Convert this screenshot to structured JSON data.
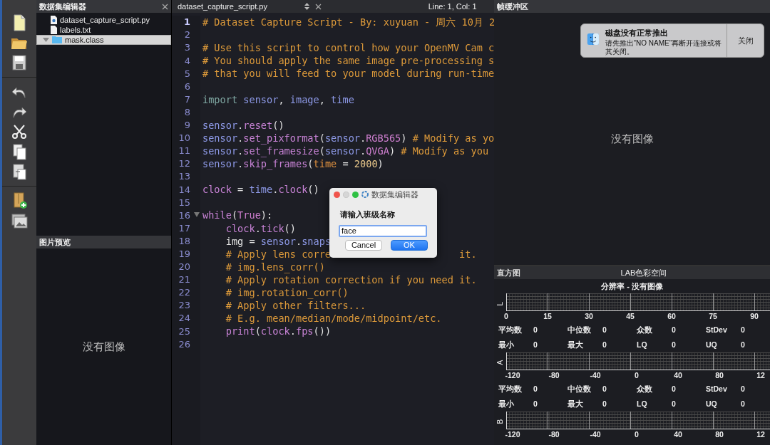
{
  "dataset_panel": {
    "title": "数据集编辑器",
    "files": [
      {
        "name": "dataset_capture_script.py",
        "kind": "python",
        "selected": false
      },
      {
        "name": "labels.txt",
        "kind": "text",
        "selected": false
      },
      {
        "name": "mask.class",
        "kind": "folder",
        "selected": true,
        "expanded": true
      }
    ],
    "preview": {
      "title": "图片预览",
      "message": "没有图像"
    }
  },
  "editor": {
    "tab": "dataset_capture_script.py",
    "position": "Line: 1, Col: 1",
    "lines": [
      {
        "number": "1",
        "current": true,
        "tokens": [
          {
            "kind": "comment",
            "t": "# Dataset Capture Script - By: xuyuan - 周六 10月 2"
          }
        ]
      },
      {
        "number": "2",
        "current": false
      },
      {
        "number": "3",
        "current": false,
        "tokens": [
          {
            "kind": "comment",
            "t": "# Use this script to control how your OpenMV Cam c"
          }
        ]
      },
      {
        "number": "4",
        "current": false,
        "tokens": [
          {
            "kind": "comment",
            "t": "# You should apply the same image pre-processing s"
          }
        ]
      },
      {
        "number": "5",
        "current": false,
        "tokens": [
          {
            "kind": "comment",
            "t": "# that you will feed to your model during run-time"
          }
        ]
      },
      {
        "number": "6",
        "current": false
      },
      {
        "number": "7",
        "current": false,
        "tokens": [
          {
            "kind": "keyword",
            "t": "import"
          },
          {
            "kind": "module",
            "t": " sensor"
          },
          {
            "kind": "plain",
            "t": ", "
          },
          {
            "kind": "module",
            "t": "image"
          },
          {
            "kind": "plain",
            "t": ", "
          },
          {
            "kind": "module",
            "t": "time"
          }
        ]
      },
      {
        "number": "8",
        "current": false
      },
      {
        "number": "9",
        "current": false,
        "tokens": [
          {
            "kind": "module",
            "t": "sensor"
          },
          {
            "kind": "plain",
            "t": "."
          },
          {
            "kind": "func",
            "t": "reset"
          },
          {
            "kind": "plain",
            "t": "()"
          }
        ]
      },
      {
        "number": "10",
        "current": false,
        "tokens": [
          {
            "kind": "module",
            "t": "sensor"
          },
          {
            "kind": "plain",
            "t": "."
          },
          {
            "kind": "func",
            "t": "set_pixformat"
          },
          {
            "kind": "plain",
            "t": "("
          },
          {
            "kind": "module",
            "t": "sensor"
          },
          {
            "kind": "plain",
            "t": "."
          },
          {
            "kind": "const",
            "t": "RGB565"
          },
          {
            "kind": "plain",
            "t": ")"
          },
          {
            "kind": "comment",
            "t": " # Modify as yo"
          }
        ]
      },
      {
        "number": "11",
        "current": false,
        "tokens": [
          {
            "kind": "module",
            "t": "sensor"
          },
          {
            "kind": "plain",
            "t": "."
          },
          {
            "kind": "func",
            "t": "set_framesize"
          },
          {
            "kind": "plain",
            "t": "("
          },
          {
            "kind": "module",
            "t": "sensor"
          },
          {
            "kind": "plain",
            "t": "."
          },
          {
            "kind": "const",
            "t": "QVGA"
          },
          {
            "kind": "plain",
            "t": ")"
          },
          {
            "kind": "comment",
            "t": " # Modify as you"
          }
        ]
      },
      {
        "number": "12",
        "current": false,
        "tokens": [
          {
            "kind": "module",
            "t": "sensor"
          },
          {
            "kind": "plain",
            "t": "."
          },
          {
            "kind": "func",
            "t": "skip_frames"
          },
          {
            "kind": "plain",
            "t": "("
          },
          {
            "kind": "param",
            "t": "time"
          },
          {
            "kind": "plain",
            "t": " = "
          },
          {
            "kind": "number",
            "t": "2000"
          },
          {
            "kind": "plain",
            "t": ")"
          }
        ]
      },
      {
        "number": "13",
        "current": false
      },
      {
        "number": "14",
        "current": false,
        "tokens": [
          {
            "kind": "func",
            "t": "clock"
          },
          {
            "kind": "plain",
            "t": " = "
          },
          {
            "kind": "module",
            "t": "time"
          },
          {
            "kind": "plain",
            "t": "."
          },
          {
            "kind": "func",
            "t": "clock"
          },
          {
            "kind": "plain",
            "t": "()"
          }
        ]
      },
      {
        "number": "15",
        "current": false
      },
      {
        "number": "16",
        "current": false,
        "foldable": true,
        "tokens": [
          {
            "kind": "func",
            "t": "while"
          },
          {
            "kind": "plain",
            "t": "("
          },
          {
            "kind": "const",
            "t": "True"
          },
          {
            "kind": "plain",
            "t": "):"
          }
        ]
      },
      {
        "number": "17",
        "current": false,
        "indented": true,
        "tokens": [
          {
            "kind": "func",
            "t": "clock"
          },
          {
            "kind": "plain",
            "t": "."
          },
          {
            "kind": "func",
            "t": "tick"
          },
          {
            "kind": "plain",
            "t": "()"
          }
        ]
      },
      {
        "number": "18",
        "current": false,
        "indented": true,
        "tokens": [
          {
            "kind": "plain",
            "t": "img = "
          },
          {
            "kind": "module",
            "t": "sensor"
          },
          {
            "kind": "plain",
            "t": "."
          },
          {
            "kind": "module",
            "t": "snaps"
          }
        ]
      },
      {
        "number": "19",
        "current": false,
        "indented": true,
        "tokens": [
          {
            "kind": "comment",
            "t": "# Apply lens corre"
          },
          {
            "kind": "comment",
            "t": "it.",
            "gap": true
          }
        ]
      },
      {
        "number": "20",
        "current": false,
        "indented": true,
        "tokens": [
          {
            "kind": "comment",
            "t": "# img.lens_corr()"
          }
        ]
      },
      {
        "number": "21",
        "current": false,
        "indented": true,
        "tokens": [
          {
            "kind": "comment",
            "t": "# Apply rotation correction if you need it."
          }
        ]
      },
      {
        "number": "22",
        "current": false,
        "indented": true,
        "tokens": [
          {
            "kind": "comment",
            "t": "# img.rotation_corr()"
          }
        ]
      },
      {
        "number": "23",
        "current": false,
        "indented": true,
        "tokens": [
          {
            "kind": "comment",
            "t": "# Apply other filters..."
          }
        ]
      },
      {
        "number": "24",
        "current": false,
        "indented": true,
        "tokens": [
          {
            "kind": "comment",
            "t": "# E.g. mean/median/mode/midpoint/etc."
          }
        ]
      },
      {
        "number": "25",
        "current": false,
        "indented": true,
        "tokens": [
          {
            "kind": "func",
            "t": "print"
          },
          {
            "kind": "plain",
            "t": "("
          },
          {
            "kind": "func",
            "t": "clock"
          },
          {
            "kind": "plain",
            "t": "."
          },
          {
            "kind": "func",
            "t": "fps"
          },
          {
            "kind": "plain",
            "t": "())"
          }
        ]
      },
      {
        "number": "26",
        "current": false
      }
    ]
  },
  "dialog": {
    "title": "数据集编辑器",
    "prompt": "请输入班级名称",
    "value": "face",
    "buttons": [
      {
        "label": "Cancel",
        "default": false
      },
      {
        "label": "OK",
        "default": true
      }
    ]
  },
  "frame_buffer": {
    "title": "帧缓冲区",
    "message": "没有图像"
  },
  "notification": {
    "title": "磁盘没有正常推出",
    "body": "请先推出“NO NAME”再断开连接或将其关闭。",
    "button": "关闭"
  },
  "histogram": {
    "title": "直方图",
    "color_space": "LAB色彩空间",
    "resolution": "分辨率 - 没有图像",
    "channels": [
      {
        "axis": "L",
        "ticks": [
          "0",
          "15",
          "30",
          "45",
          "60",
          "75",
          "90"
        ],
        "stats": [
          {
            "label": "平均数",
            "value": "0"
          },
          {
            "label": "中位数",
            "value": "0"
          },
          {
            "label": "众数",
            "value": "0"
          },
          {
            "label": "StDev",
            "value": "0"
          },
          {
            "label": "最小",
            "value": "0"
          },
          {
            "label": "最大",
            "value": "0"
          },
          {
            "label": "LQ",
            "value": "0"
          },
          {
            "label": "UQ",
            "value": "0"
          }
        ]
      },
      {
        "axis": "A",
        "ticks": [
          "-120",
          "-80",
          "-40",
          "0",
          "40",
          "80",
          "12"
        ],
        "stats": [
          {
            "label": "平均数",
            "value": "0"
          },
          {
            "label": "中位数",
            "value": "0"
          },
          {
            "label": "众数",
            "value": "0"
          },
          {
            "label": "StDev",
            "value": "0"
          },
          {
            "label": "最小",
            "value": "0"
          },
          {
            "label": "最大",
            "value": "0"
          },
          {
            "label": "LQ",
            "value": "0"
          },
          {
            "label": "UQ",
            "value": "0"
          }
        ]
      },
      {
        "axis": "B",
        "ticks": [
          "-120",
          "-80",
          "-40",
          "0",
          "40",
          "80",
          "12"
        ]
      }
    ]
  }
}
